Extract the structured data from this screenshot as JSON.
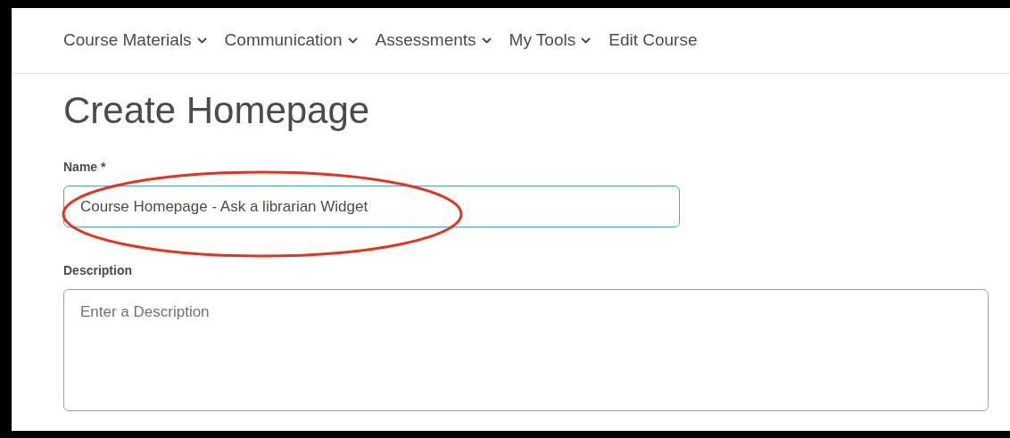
{
  "nav": [
    {
      "label": "Course Materials",
      "has_menu": true
    },
    {
      "label": "Communication",
      "has_menu": true
    },
    {
      "label": "Assessments",
      "has_menu": true
    },
    {
      "label": "My Tools",
      "has_menu": true
    },
    {
      "label": "Edit Course",
      "has_menu": false
    }
  ],
  "title": "Create Homepage",
  "name_field": {
    "label": "Name *",
    "value": "Course Homepage - Ask a librarian Widget"
  },
  "description_field": {
    "label": "Description",
    "placeholder": "Enter a Description"
  }
}
